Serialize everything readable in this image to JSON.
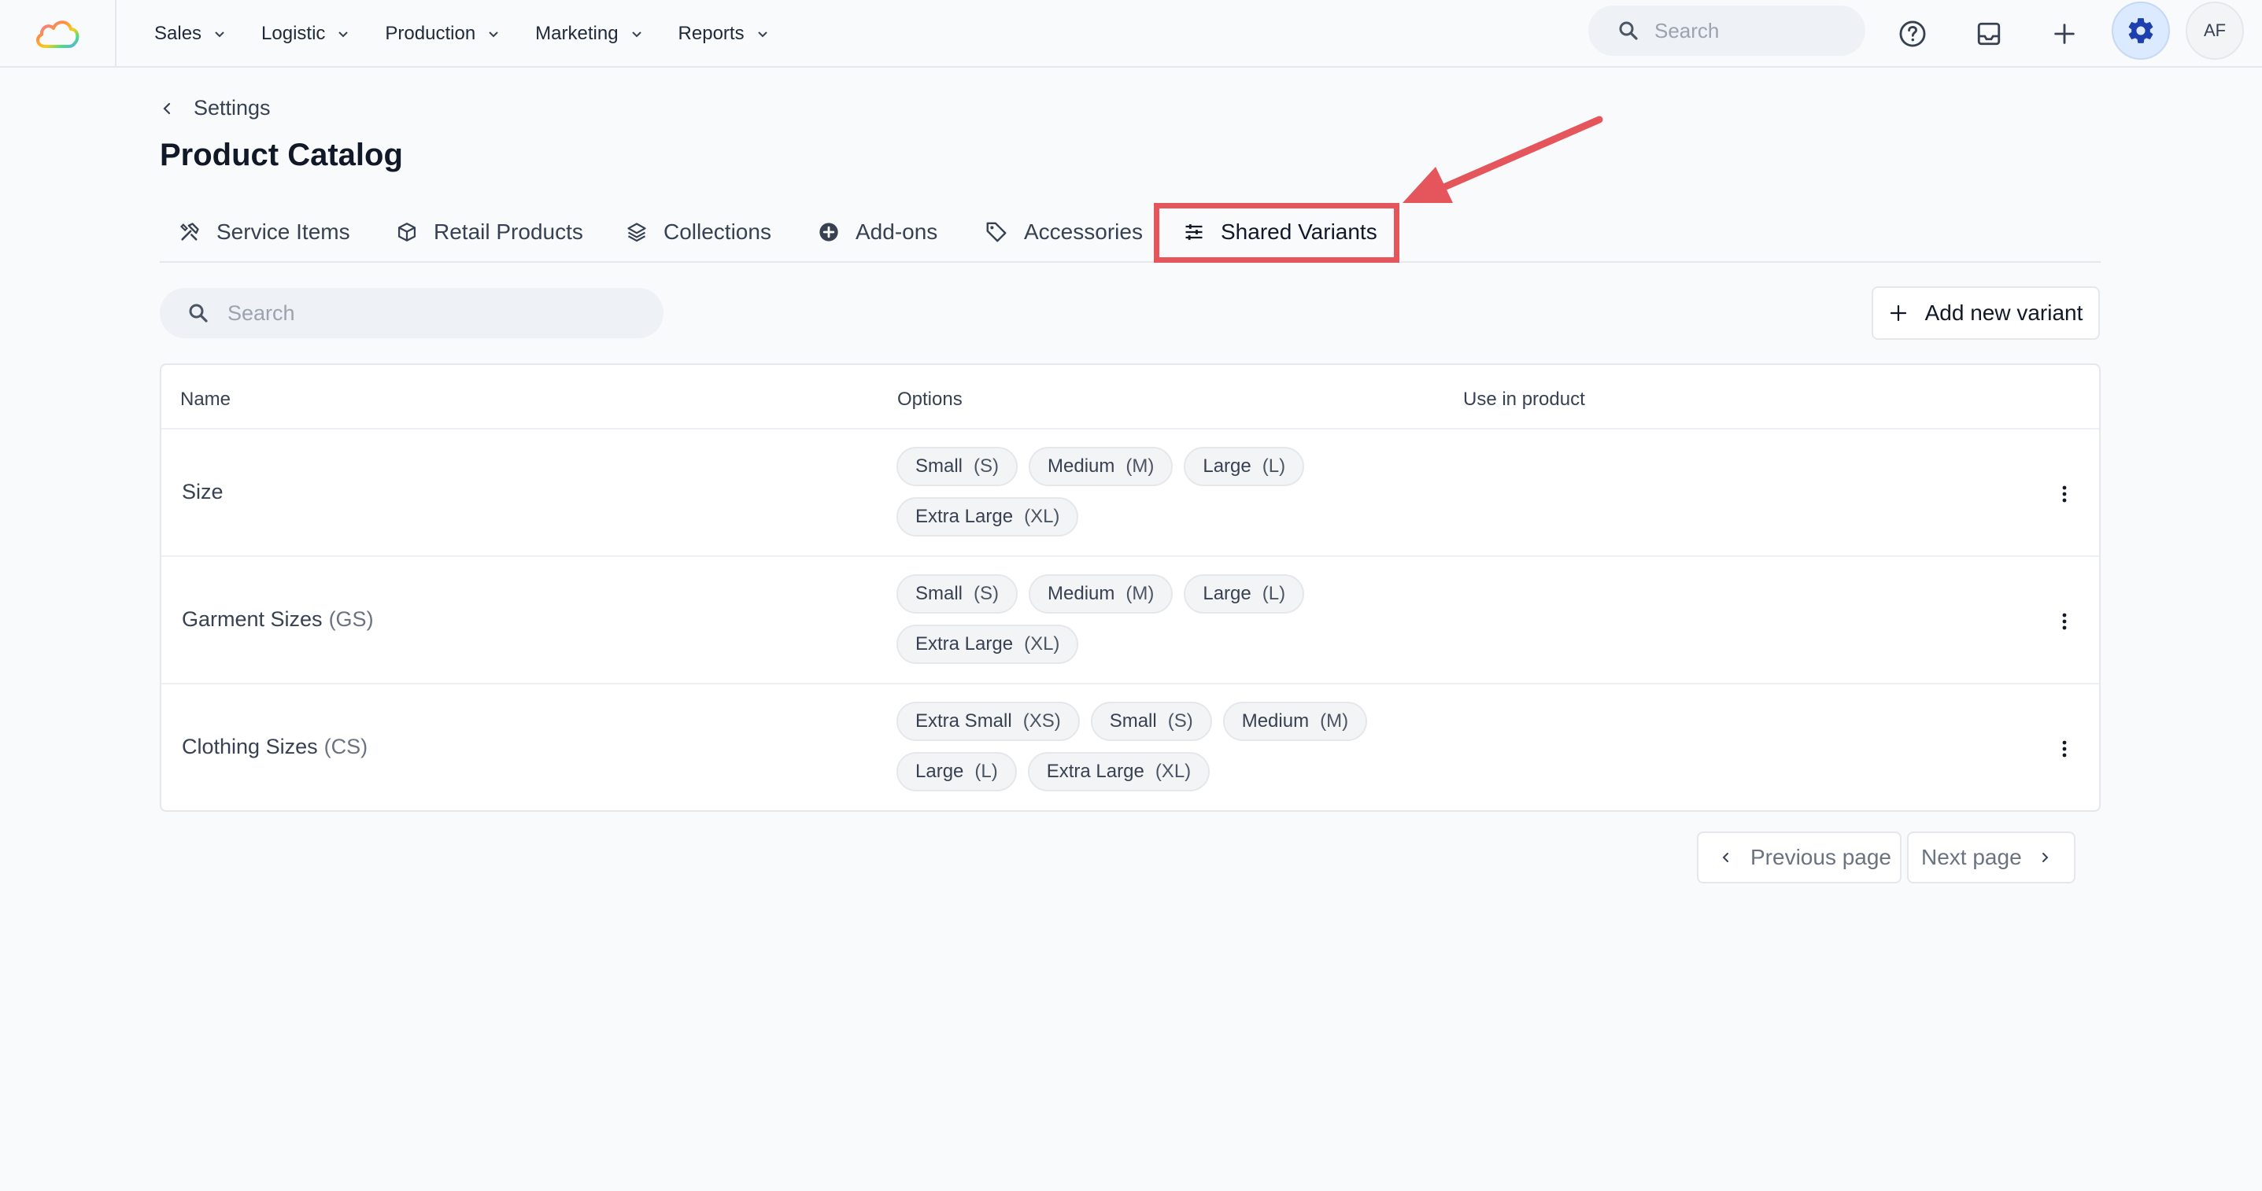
{
  "nav": {
    "items": [
      {
        "label": "Sales"
      },
      {
        "label": "Logistic"
      },
      {
        "label": "Production"
      },
      {
        "label": "Marketing"
      },
      {
        "label": "Reports"
      }
    ],
    "search_placeholder": "Search",
    "avatar_initials": "AF"
  },
  "header": {
    "breadcrumb": "Settings",
    "title": "Product Catalog"
  },
  "tabs": [
    {
      "label": "Service Items",
      "icon": "tools-icon"
    },
    {
      "label": "Retail Products",
      "icon": "box-icon"
    },
    {
      "label": "Collections",
      "icon": "layers-icon"
    },
    {
      "label": "Add-ons",
      "icon": "plus-circle-icon"
    },
    {
      "label": "Accessories",
      "icon": "tag-icon"
    },
    {
      "label": "Shared Variants",
      "icon": "sliders-icon",
      "active": true
    }
  ],
  "toolbar": {
    "search_placeholder": "Search",
    "add_label": "Add new variant"
  },
  "table": {
    "columns": [
      "Name",
      "Options",
      "Use in product"
    ],
    "rows": [
      {
        "name": "Size",
        "code": "",
        "options": [
          {
            "label": "Small",
            "abbr": "(S)"
          },
          {
            "label": "Medium",
            "abbr": "(M)"
          },
          {
            "label": "Large",
            "abbr": "(L)"
          },
          {
            "label": "Extra Large",
            "abbr": "(XL)"
          }
        ]
      },
      {
        "name": "Garment Sizes",
        "code": "(GS)",
        "options": [
          {
            "label": "Small",
            "abbr": "(S)"
          },
          {
            "label": "Medium",
            "abbr": "(M)"
          },
          {
            "label": "Large",
            "abbr": "(L)"
          },
          {
            "label": "Extra Large",
            "abbr": "(XL)"
          }
        ]
      },
      {
        "name": "Clothing Sizes",
        "code": "(CS)",
        "options": [
          {
            "label": "Extra Small",
            "abbr": "(XS)"
          },
          {
            "label": "Small",
            "abbr": "(S)"
          },
          {
            "label": "Medium",
            "abbr": "(M)"
          },
          {
            "label": "Large",
            "abbr": "(L)"
          },
          {
            "label": "Extra Large",
            "abbr": "(XL)"
          }
        ]
      }
    ]
  },
  "pagination": {
    "prev_label": "Previous page",
    "next_label": "Next page"
  },
  "colors": {
    "highlight": "#e5565c",
    "gear_bg": "#dbeafe",
    "gear_icon": "#1e40af"
  }
}
